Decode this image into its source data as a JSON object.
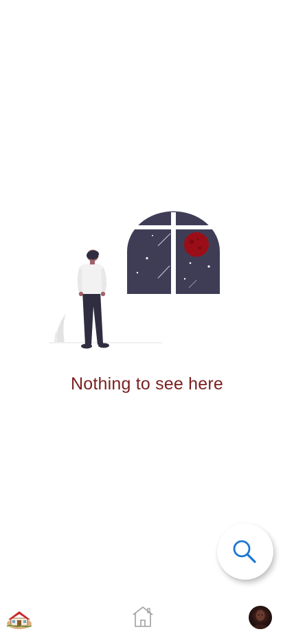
{
  "empty_state": {
    "message": "Nothing to see here"
  },
  "colors": {
    "message_text": "#7a1f1f",
    "window_fill": "#3f3d56",
    "moon": "#9b0e17",
    "accent_blue": "#1976d2",
    "nav_icon": "#9e9e9e"
  },
  "icons": {
    "fab": "search-icon",
    "nav_left": "house-logo-icon",
    "nav_center": "home-icon",
    "nav_right": "profile-avatar"
  }
}
